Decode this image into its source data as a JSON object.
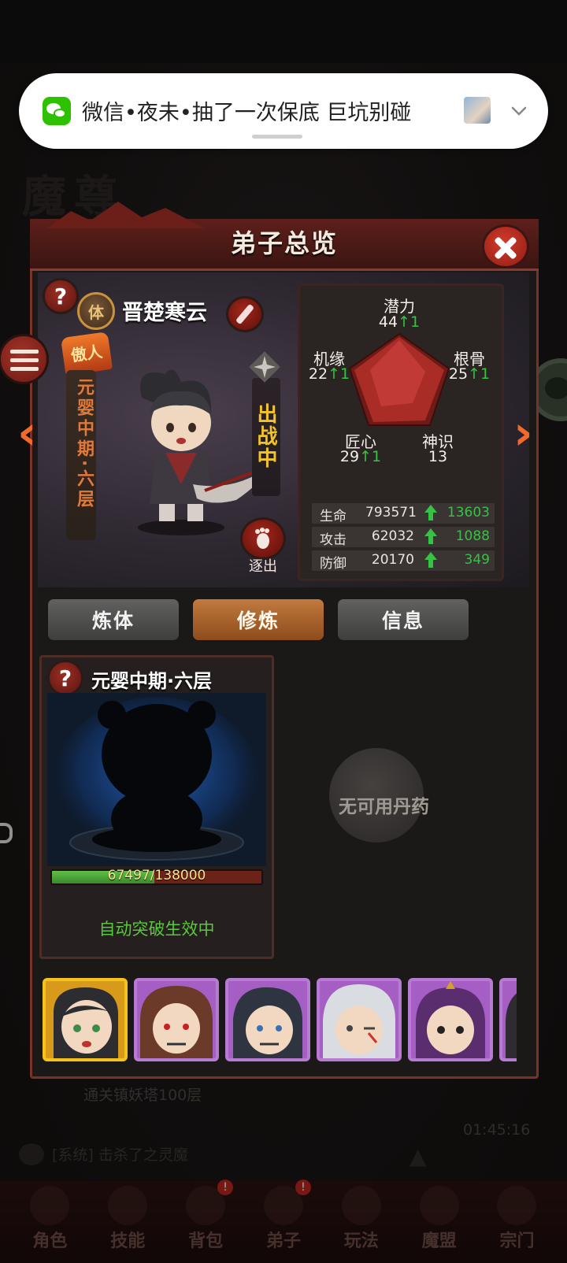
{
  "notification": {
    "text": "微信•夜未•抽了一次保底 巨坑别碰"
  },
  "panel": {
    "title": "弟子总览"
  },
  "character": {
    "name": "晋楚寒云",
    "body_type": "体",
    "talent_badge": "傲人",
    "realm_vertical": "元婴中期·六层",
    "deployed_status": "出战中",
    "expel_label": "逐出"
  },
  "attributes": {
    "potential": {
      "label": "潜力",
      "value": "44",
      "inc": "1"
    },
    "fortune": {
      "label": "机缘",
      "value": "22",
      "inc": "1"
    },
    "root": {
      "label": "根骨",
      "value": "25",
      "inc": "1"
    },
    "craft": {
      "label": "匠心",
      "value": "29",
      "inc": "1"
    },
    "spirit": {
      "label": "神识",
      "value": "13"
    }
  },
  "combat": [
    {
      "label": "生命",
      "value": "793571",
      "inc": "13603"
    },
    {
      "label": "攻击",
      "value": "62032",
      "inc": "1088"
    },
    {
      "label": "防御",
      "value": "20170",
      "inc": "349"
    }
  ],
  "tabs": [
    {
      "label": "炼体",
      "active": false
    },
    {
      "label": "修炼",
      "active": true
    },
    {
      "label": "信息",
      "active": false
    }
  ],
  "cultivation": {
    "realm": "元婴中期·六层",
    "exp_current": 67497,
    "exp_max": 138000,
    "exp_text": "67497/138000",
    "auto_breakthrough": "自动突破生效中"
  },
  "pills": {
    "empty_text": "无可用丹药"
  },
  "roster": {
    "count_visible": 6,
    "selected_index": 0
  },
  "background": {
    "feed_line_1": "通关镇妖塔100层",
    "feed_line_2": "[系统] 击杀了之灵魔",
    "feed_time": "01:45:16"
  },
  "bottom_nav": [
    {
      "label": "角色",
      "badge": ""
    },
    {
      "label": "技能",
      "badge": ""
    },
    {
      "label": "背包",
      "badge": "!"
    },
    {
      "label": "弟子",
      "badge": "!"
    },
    {
      "label": "玩法",
      "badge": ""
    },
    {
      "label": "魔盟",
      "badge": ""
    },
    {
      "label": "宗门",
      "badge": ""
    }
  ],
  "colors": {
    "accent_red": "#8e1d14",
    "tab_active": "#c27a3e",
    "roster_selected": "#f5c21a",
    "roster_slot": "#a55fc4",
    "stat_up_green": "#36c244",
    "realm_orange": "#e07a3a",
    "deployed_gold": "#f4c326"
  }
}
